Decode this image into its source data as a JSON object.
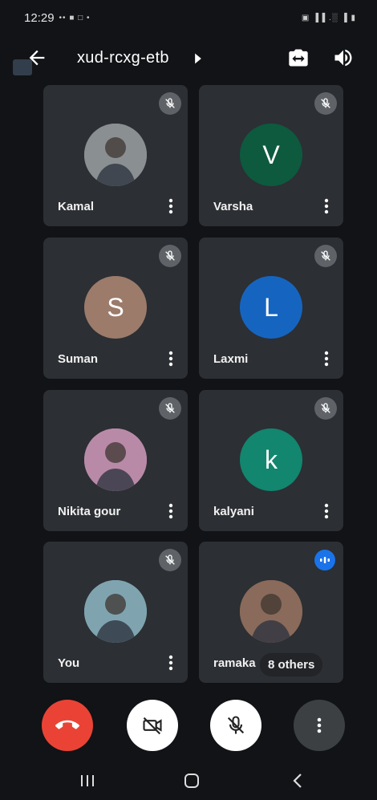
{
  "status_bar": {
    "time": "12:29",
    "left_icons": "•• ■ □ •",
    "right_icons": "▣ ▐▐ .░ ▐ ▮"
  },
  "meeting": {
    "title": "xud-rcxg-etb"
  },
  "participants": [
    {
      "name": "Kamal",
      "initial": "",
      "avatar_color": "#8a8f92",
      "muted": true,
      "photo": true
    },
    {
      "name": "Varsha",
      "initial": "V",
      "avatar_color": "#0d5a3f",
      "muted": true,
      "photo": false
    },
    {
      "name": "Suman",
      "initial": "S",
      "avatar_color": "#9c7b6b",
      "muted": true,
      "photo": false
    },
    {
      "name": "Laxmi",
      "initial": "L",
      "avatar_color": "#1565c0",
      "muted": true,
      "photo": false
    },
    {
      "name": "Nikita gour",
      "initial": "",
      "avatar_color": "#b98aa8",
      "muted": true,
      "photo": true
    },
    {
      "name": "kalyani",
      "initial": "k",
      "avatar_color": "#12866f",
      "muted": true,
      "photo": false
    },
    {
      "name": "You",
      "initial": "",
      "avatar_color": "#7fa4b0",
      "muted": true,
      "photo": true
    },
    {
      "name": "ramaka",
      "initial": "",
      "avatar_color": "#8a6a5a",
      "muted": false,
      "speaking": true,
      "photo": true
    }
  ],
  "others_chip": "8 others",
  "controls": {
    "end_call_color": "#ea4335",
    "button_color": "#ffffff",
    "more_button_color": "#3c4043"
  }
}
